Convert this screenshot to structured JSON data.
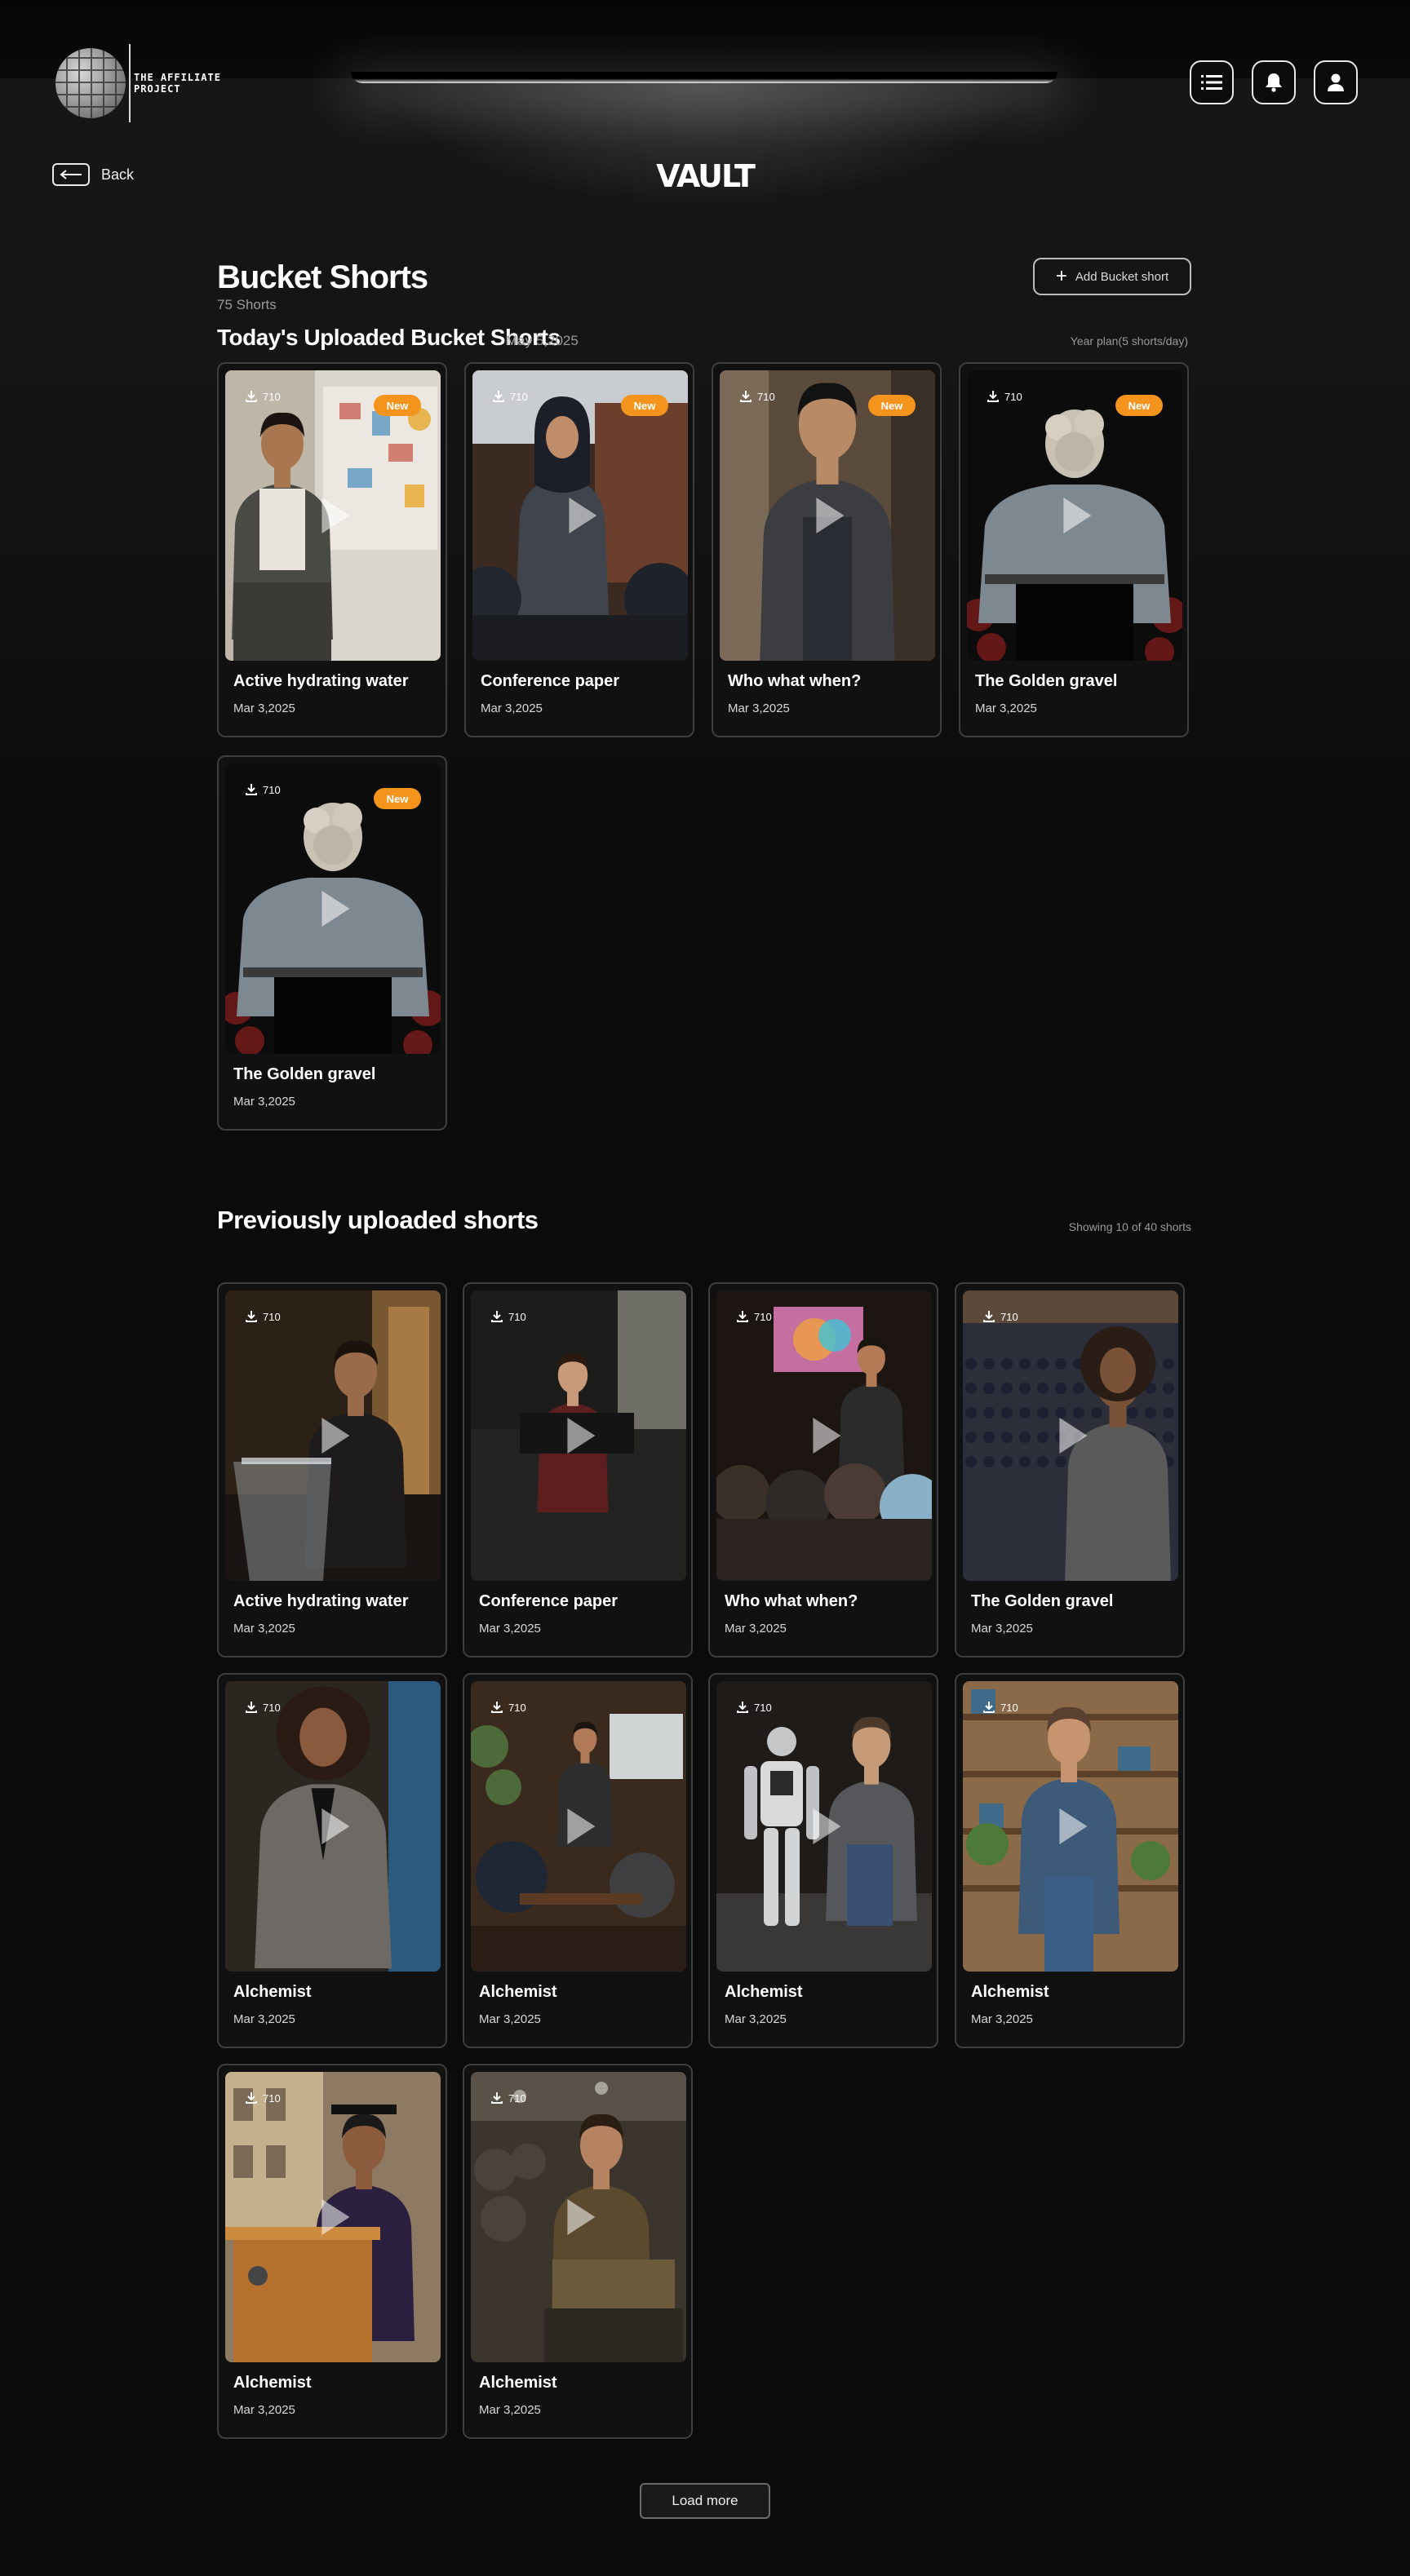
{
  "brand": {
    "logo_text": "THE AFFILIATE PROJECT"
  },
  "header": {
    "app_title": "VAULT",
    "back_label": "Back",
    "icons": [
      "menu-list-icon",
      "bell-icon",
      "user-icon"
    ]
  },
  "bucket": {
    "title": "Bucket Shorts",
    "count_label": "75 Shorts",
    "add_label": "Add Bucket short"
  },
  "today": {
    "title": "Today's Uploaded Bucket Shorts",
    "date": "May 5,2025",
    "plan_label": "Year plan(5 shorts/day)",
    "badge_label": "New",
    "cards": [
      {
        "title": "Active hydrating water",
        "date": "Mar 3,2025",
        "downloads": "710",
        "scene": "designer"
      },
      {
        "title": "Conference paper",
        "date": "Mar 3,2025",
        "downloads": "710",
        "scene": "hijab-speaker"
      },
      {
        "title": "Who what when?",
        "date": "Mar 3,2025",
        "downloads": "710",
        "scene": "presenter"
      },
      {
        "title": "The Golden gravel",
        "date": "Mar 3,2025",
        "downloads": "710",
        "scene": "podium-back"
      },
      {
        "title": "The Golden gravel",
        "date": "Mar 3,2025",
        "downloads": "710",
        "scene": "podium-back"
      }
    ]
  },
  "previous": {
    "title": "Previously uploaded shorts",
    "showing_label": "Showing 10 of 40 shorts",
    "cards": [
      {
        "title": "Active hydrating water",
        "date": "Mar 3,2025",
        "downloads": "710",
        "scene": "lectern"
      },
      {
        "title": "Conference paper",
        "date": "Mar 3,2025",
        "downloads": "710",
        "scene": "dark-room"
      },
      {
        "title": "Who what when?",
        "date": "Mar 3,2025",
        "downloads": "710",
        "scene": "audience"
      },
      {
        "title": "The Golden gravel",
        "date": "Mar 3,2025",
        "downloads": "710",
        "scene": "auditorium"
      },
      {
        "title": "Alchemist",
        "date": "Mar 3,2025",
        "downloads": "710",
        "scene": "curly-speaker"
      },
      {
        "title": "Alchemist",
        "date": "Mar 3,2025",
        "downloads": "710",
        "scene": "cafe"
      },
      {
        "title": "Alchemist",
        "date": "Mar 3,2025",
        "downloads": "710",
        "scene": "robot"
      },
      {
        "title": "Alchemist",
        "date": "Mar 3,2025",
        "downloads": "710",
        "scene": "shelves"
      },
      {
        "title": "Alchemist",
        "date": "Mar 3,2025",
        "downloads": "710",
        "scene": "graduation"
      },
      {
        "title": "Alchemist",
        "date": "Mar 3,2025",
        "downloads": "710",
        "scene": "seated-man"
      }
    ]
  },
  "load_more_label": "Load more",
  "colors": {
    "accent_badge": "#f5941d",
    "background": "#0b0b0b",
    "card_border": "#3e3e3e"
  }
}
